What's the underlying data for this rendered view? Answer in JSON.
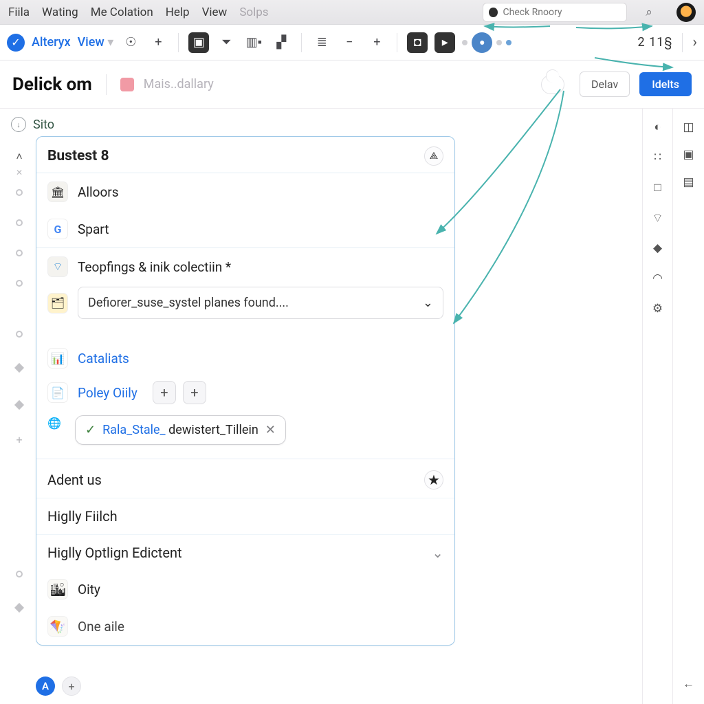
{
  "menubar": {
    "items": [
      "Fiila",
      "Wating",
      "Me Colation",
      "Help",
      "View"
    ],
    "disabled_item": "Solps",
    "search_placeholder": "Check Rnoory"
  },
  "toolbar": {
    "brand": "Alteryx",
    "view_label": "View",
    "right_counter": "2  11§"
  },
  "page": {
    "title": "Delick om",
    "subtitle": "Mais..dallary",
    "btn_secondary": "Delav",
    "btn_primary": "Idelts"
  },
  "sito": {
    "label": "Sito",
    "badge": "↓"
  },
  "card": {
    "title": "Bustest 8",
    "rows": {
      "alloors": "Alloors",
      "spart": "Spart",
      "teopfings": "Teopfings & inik colectiin *",
      "defiorer_dd": "Defiorer_suse_systel planes found....",
      "cataliats": "Cataliats",
      "poley": "Poley Oiily"
    },
    "tag_chip": {
      "blue": "Rala_Stale_",
      "rest": " dewistert_Tillein"
    },
    "section": {
      "adent": "Adent us",
      "higlly_fiilch": "Higlly Fiilch",
      "higlly_optlign": "Higlly Optlign Edictent",
      "oity": "Oity",
      "one_aile": "One aile"
    }
  },
  "bottom": {
    "letter": "A"
  },
  "icons": {
    "caret": "▾",
    "plus": "+",
    "minus": "−",
    "check": "✓",
    "star": "★",
    "pin": "⟁",
    "chev_down": "⌄",
    "chev_right": "›",
    "close": "✕",
    "gear": "⚙",
    "clock": "◐",
    "grid": "⛶",
    "square": "□",
    "wifi": "▾",
    "tag": "◆",
    "headphones": "◠",
    "back": "←",
    "search": "⌕",
    "list": "≣",
    "picture": "▣"
  },
  "colors": {
    "accent": "#1f6fe5",
    "card_border": "#9fc9e8",
    "teal": "#49b3ae"
  }
}
